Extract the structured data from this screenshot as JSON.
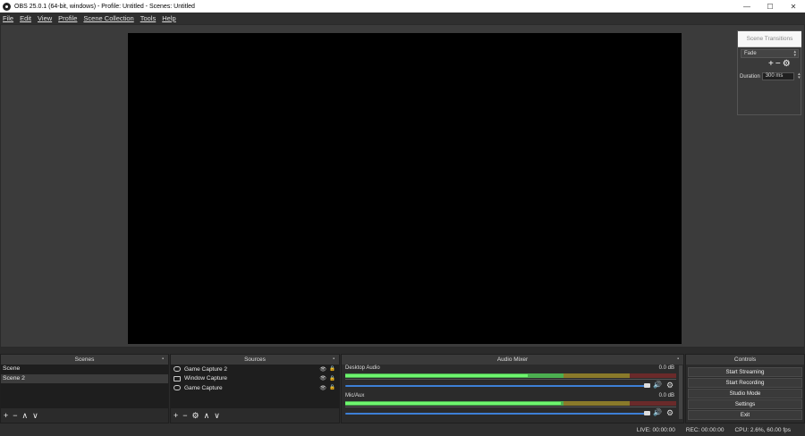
{
  "window": {
    "title": "OBS 25.0.1 (64-bit, windows) - Profile: Untitled - Scenes: Untitled",
    "minimize_label": "—",
    "maximize_label": "☐",
    "close_label": "✕"
  },
  "menu": {
    "items": [
      "File",
      "Edit",
      "View",
      "Profile",
      "Scene Collection",
      "Tools",
      "Help"
    ]
  },
  "transitions": {
    "title": "Scene Transitions",
    "selected": "Fade",
    "add_label": "+",
    "remove_label": "−",
    "settings_label": "⚙",
    "duration_label": "Duration",
    "duration_value": "300 ms"
  },
  "scenes": {
    "title": "Scenes",
    "items": [
      "Scene",
      "Scene 2"
    ],
    "selected_index": 1,
    "footer": [
      "+",
      "−",
      "∧",
      "∨"
    ]
  },
  "sources": {
    "title": "Sources",
    "items": [
      {
        "name": "Game Capture 2",
        "type": "game"
      },
      {
        "name": "Window Capture",
        "type": "window"
      },
      {
        "name": "Game Capture",
        "type": "game"
      }
    ],
    "footer": [
      "+",
      "−",
      "⚙",
      "∧",
      "∨"
    ]
  },
  "audio_mixer": {
    "title": "Audio Mixer",
    "channels": [
      {
        "name": "Desktop Audio",
        "db": "0.0 dB",
        "level": 0.55,
        "volume": 1.0
      },
      {
        "name": "Mic/Aux",
        "db": "0.0 dB",
        "level": 0.65,
        "volume": 1.0
      }
    ]
  },
  "controls": {
    "title": "Controls",
    "buttons": [
      "Start Streaming",
      "Start Recording",
      "Studio Mode",
      "Settings",
      "Exit"
    ]
  },
  "status": {
    "live": "LIVE: 00:00:00",
    "rec": "REC: 00:00:00",
    "cpu": "CPU: 2.6%, 60.00 fps"
  }
}
